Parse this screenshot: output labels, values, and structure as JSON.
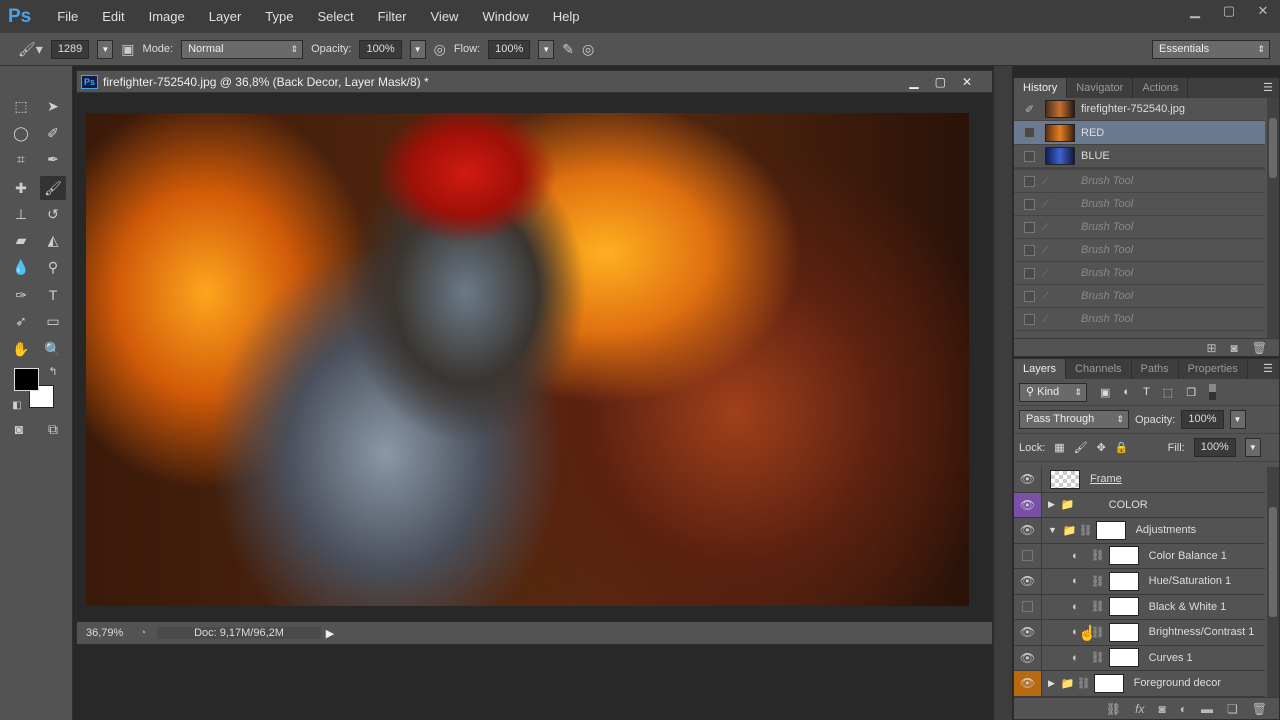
{
  "app": {
    "logo": "Ps"
  },
  "menu": [
    "File",
    "Edit",
    "Image",
    "Layer",
    "Type",
    "Select",
    "Filter",
    "View",
    "Window",
    "Help"
  ],
  "window_controls": {
    "minimize": "▁",
    "maximize": "▢",
    "close": "✕"
  },
  "options": {
    "brush_size": "1289",
    "mode_label": "Mode:",
    "mode": "Normal",
    "opacity_label": "Opacity:",
    "opacity": "100%",
    "flow_label": "Flow:",
    "flow": "100%",
    "workspace": "Essentials"
  },
  "document": {
    "title": "firefighter-752540.jpg @ 36,8% (Back Decor, Layer Mask/8) *",
    "zoom": "36,79%",
    "doc_size": "Doc: 9,17M/96,2M",
    "controls": {
      "minimize": "▁",
      "maximize": "▢",
      "close": "✕"
    }
  },
  "history": {
    "tabs": [
      "History",
      "Navigator",
      "Actions"
    ],
    "snapshots": [
      {
        "label": "firefighter-752540.jpg"
      },
      {
        "label": "RED"
      },
      {
        "label": "BLUE"
      }
    ],
    "steps": [
      "Brush Tool",
      "Brush Tool",
      "Brush Tool",
      "Brush Tool",
      "Brush Tool",
      "Brush Tool",
      "Brush Tool"
    ]
  },
  "layers": {
    "tabs": [
      "Layers",
      "Channels",
      "Paths",
      "Properties"
    ],
    "filter": "Kind",
    "blend_mode": "Pass Through",
    "opacity_label": "Opacity:",
    "opacity": "100%",
    "lock_label": "Lock:",
    "fill_label": "Fill:",
    "fill": "100%",
    "items": [
      {
        "name": "Frame",
        "visible": true
      },
      {
        "name": "COLOR",
        "visible": true,
        "color": "#7a4fa8"
      },
      {
        "name": "Adjustments",
        "visible": true
      },
      {
        "name": "Color Balance 1",
        "visible": false
      },
      {
        "name": "Hue/Saturation 1",
        "visible": true
      },
      {
        "name": "Black & White 1",
        "visible": false
      },
      {
        "name": "Brightness/Contrast 1",
        "visible": true
      },
      {
        "name": "Curves 1",
        "visible": true
      },
      {
        "name": "Foreground decor",
        "visible": true,
        "color": "#b86a10"
      }
    ]
  }
}
